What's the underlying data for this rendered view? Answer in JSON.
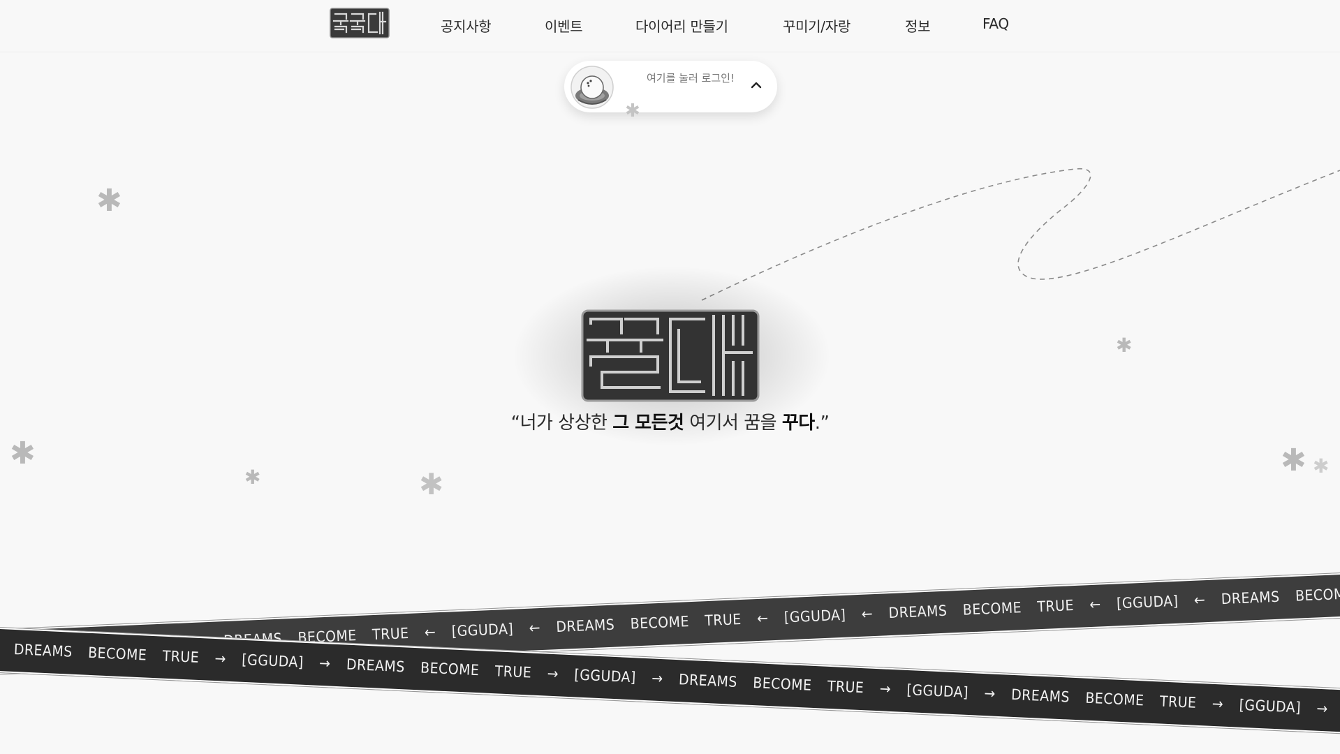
{
  "header": {
    "logo_text": "꾸다",
    "nav": [
      {
        "label": "공지사항"
      },
      {
        "label": "이벤트"
      },
      {
        "label": "다이어리 만들기"
      },
      {
        "label": "꾸미기/자랑"
      },
      {
        "label": "정보"
      },
      {
        "label": "FAQ"
      }
    ]
  },
  "login": {
    "prompt": "여기를 눌러 로그인!",
    "avatar_icon": "cat-avatar-icon",
    "toggle_icon": "chevron-up-icon"
  },
  "hero": {
    "logo_text": "꾸다",
    "tagline": {
      "open_quote": "“",
      "part1": "너가 상상한 ",
      "bold1": "그 모든것",
      "part2": " 여기서 꿈을 ",
      "bold2": "꾸다",
      "close": ".”"
    }
  },
  "ribbons": {
    "top_text": "[GGUDA]  ←  DREAMS  BECOME  TRUE  ←  [GGUDA]  ←  DREAMS  BECOME  TRUE  ←  [GGUDA]  ←  DREAMS  BECOME  TRUE  ←  [GGUDA]  ←  DREAMS  BECOME  TRUE  ←  [GGUDA]",
    "bottom_text": "→  DREAMS  BECOME  TRUE  →  [GGUDA]  →  DREAMS  BECOME  TRUE  →  [GGUDA]  →  DREAMS  BECOME  TRUE  →  [GGUDA]  →  DREAMS  BECOME  TRUE  →  [GGUDA]  →  DREAMS  BECOME  TRUE"
  },
  "decor": {
    "star_glyph": "✱",
    "colors": {
      "background": "#f8f8f8",
      "ribbon": "#3d3d3d",
      "ribbon_text": "#f2f2f2",
      "logo": "#3a3a3a"
    }
  }
}
